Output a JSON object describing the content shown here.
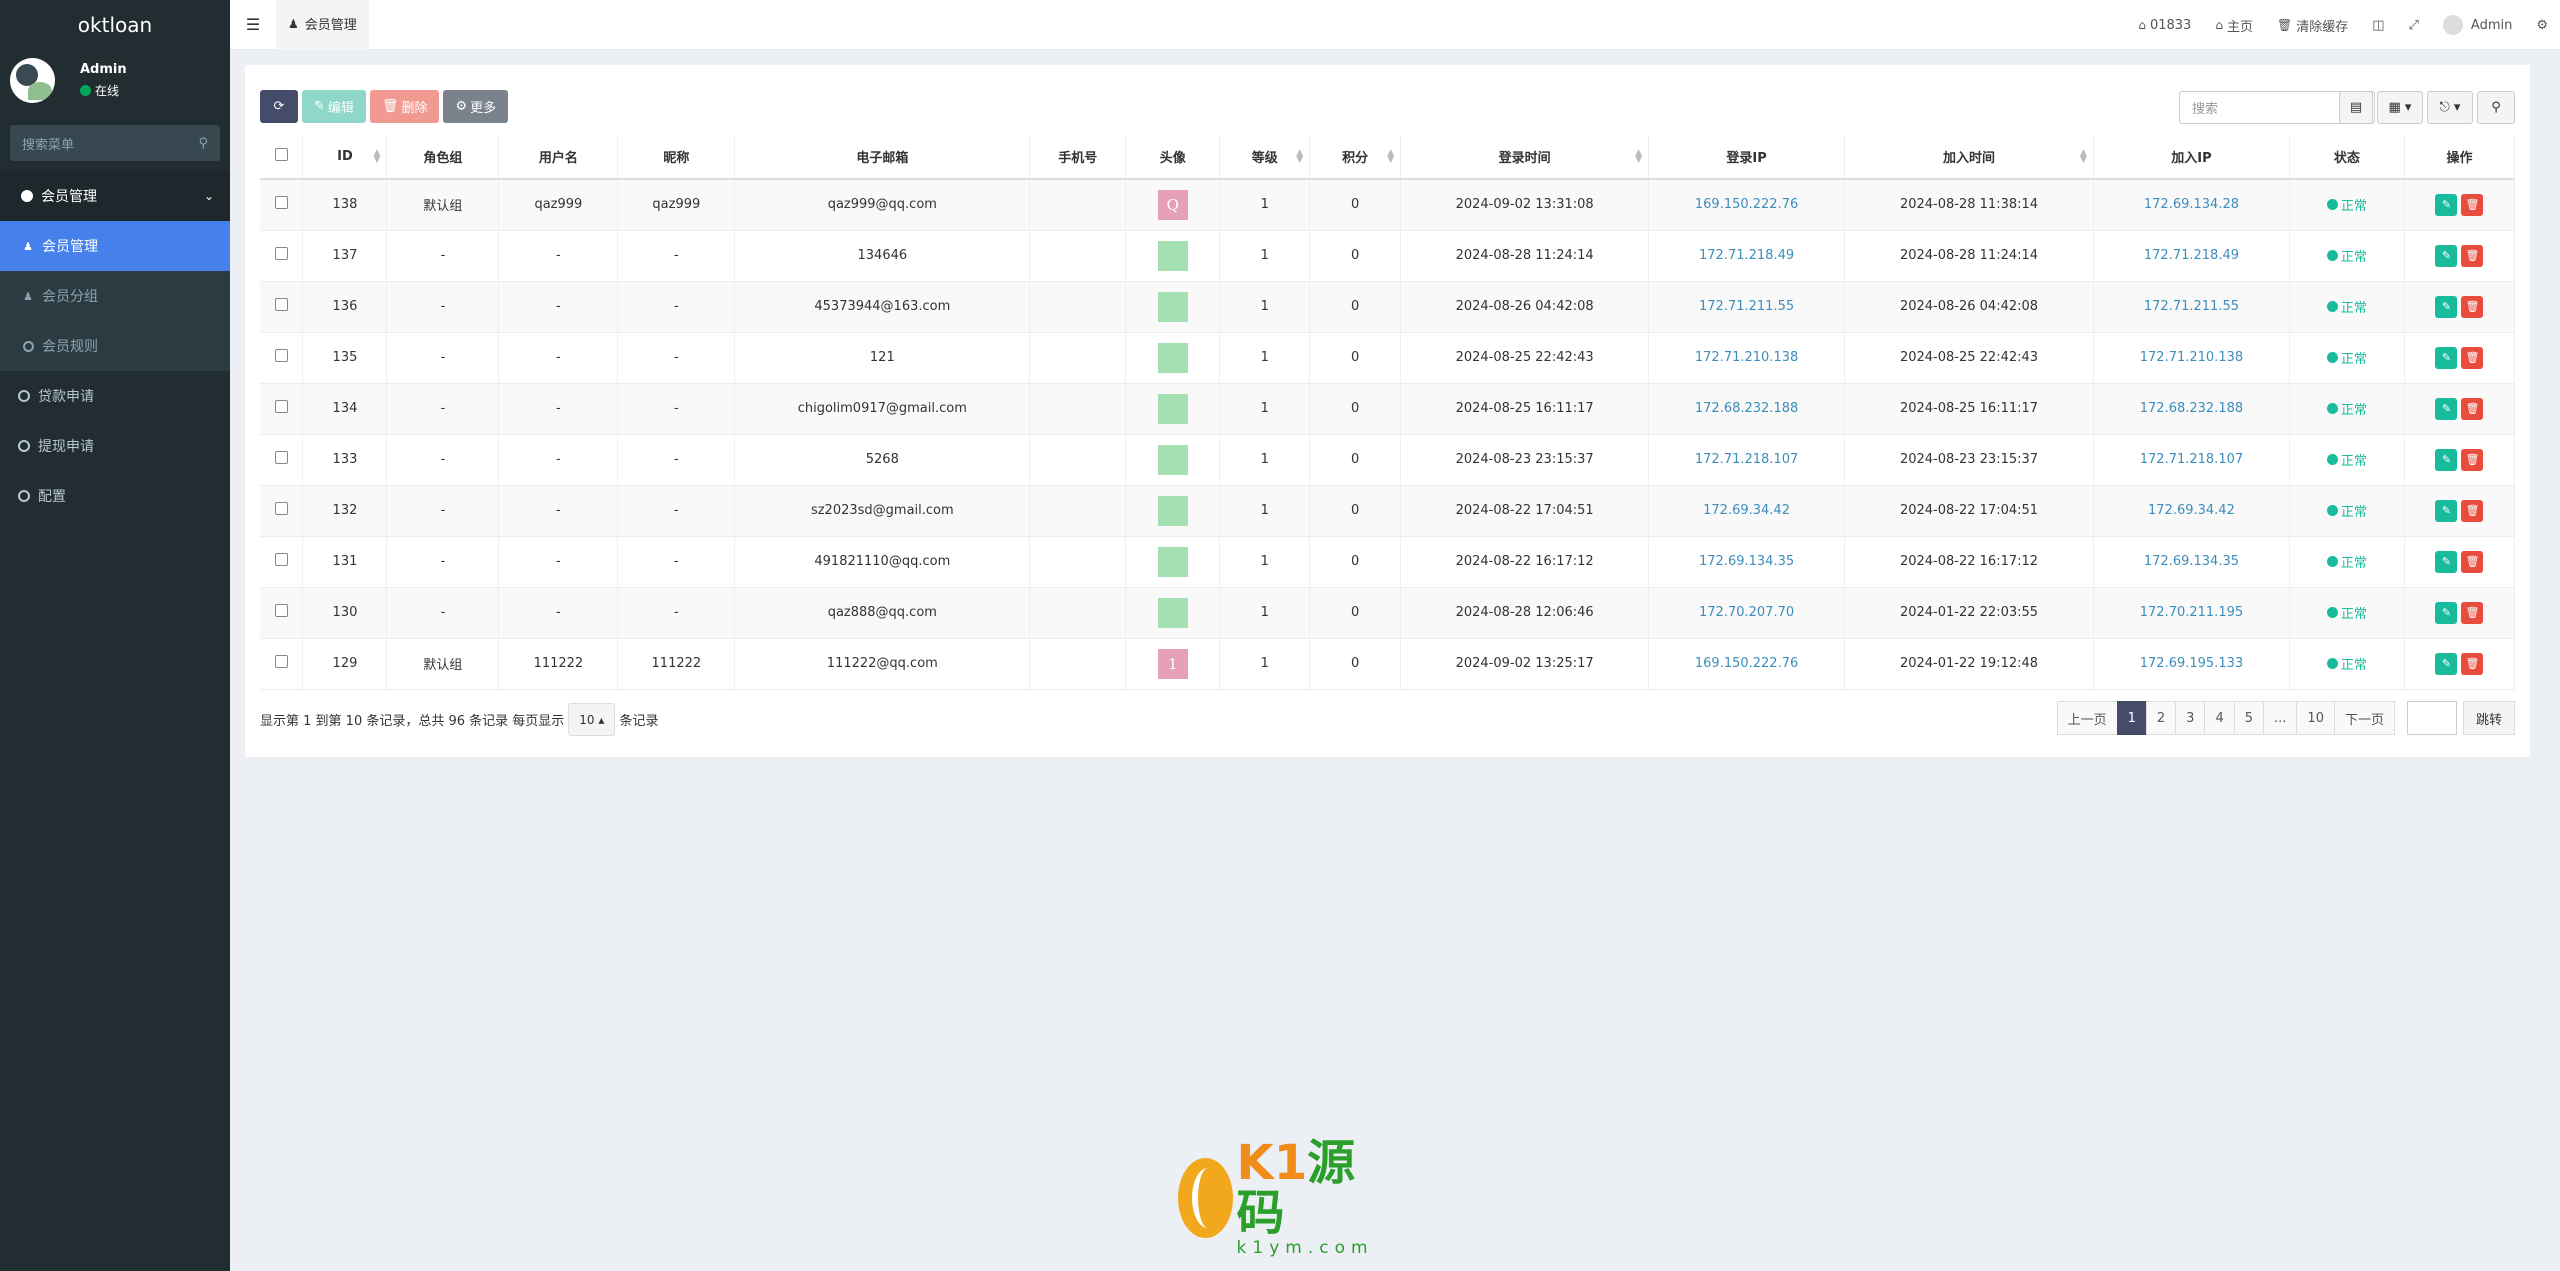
{
  "app": {
    "logo": "oktloan"
  },
  "user": {
    "name": "Admin",
    "status": "在线"
  },
  "sidebar": {
    "search_placeholder": "搜索菜单",
    "group_label": "会员管理",
    "sub_items": [
      {
        "label": "会员管理",
        "active": true,
        "icon": "user-icon"
      },
      {
        "label": "会员分组",
        "active": false,
        "icon": "users-icon"
      },
      {
        "label": "会员规则",
        "active": false,
        "icon": "circle-icon"
      }
    ],
    "items": [
      {
        "label": "贷款申请",
        "icon": "circle-icon"
      },
      {
        "label": "提现申请",
        "icon": "circle-icon"
      },
      {
        "label": "配置",
        "icon": "circle-icon"
      }
    ]
  },
  "topbar": {
    "tab_label": "会员管理",
    "code": "01833",
    "home": "主页",
    "clear_cache": "清除缓存",
    "admin": "Admin"
  },
  "toolbar": {
    "edit": "编辑",
    "delete": "删除",
    "more": "更多",
    "search_placeholder": "搜索"
  },
  "table": {
    "columns": [
      "ID",
      "角色组",
      "用户名",
      "昵称",
      "电子邮箱",
      "手机号",
      "头像",
      "等级",
      "积分",
      "登录时间",
      "登录IP",
      "加入时间",
      "加入IP",
      "状态",
      "操作"
    ],
    "rows": [
      {
        "id": "138",
        "group": "默认组",
        "username": "qaz999",
        "nickname": "qaz999",
        "email": "qaz999@qq.com",
        "mobile": "",
        "avatar_letter": "Q",
        "avatar_color": "#e7a1b6",
        "level": "1",
        "score": "0",
        "logintime": "2024-09-02 13:31:08",
        "loginip": "169.150.222.76",
        "jointime": "2024-08-28 11:38:14",
        "joinip": "172.69.134.28",
        "status": "正常"
      },
      {
        "id": "137",
        "group": "-",
        "username": "-",
        "nickname": "-",
        "email": "134646",
        "mobile": "",
        "avatar_letter": "",
        "avatar_color": "#a4e0b1",
        "level": "1",
        "score": "0",
        "logintime": "2024-08-28 11:24:14",
        "loginip": "172.71.218.49",
        "jointime": "2024-08-28 11:24:14",
        "joinip": "172.71.218.49",
        "status": "正常"
      },
      {
        "id": "136",
        "group": "-",
        "username": "-",
        "nickname": "-",
        "email": "45373944@163.com",
        "mobile": "",
        "avatar_letter": "",
        "avatar_color": "#a4e0b1",
        "level": "1",
        "score": "0",
        "logintime": "2024-08-26 04:42:08",
        "loginip": "172.71.211.55",
        "jointime": "2024-08-26 04:42:08",
        "joinip": "172.71.211.55",
        "status": "正常"
      },
      {
        "id": "135",
        "group": "-",
        "username": "-",
        "nickname": "-",
        "email": "121",
        "mobile": "",
        "avatar_letter": "",
        "avatar_color": "#a4e0b1",
        "level": "1",
        "score": "0",
        "logintime": "2024-08-25 22:42:43",
        "loginip": "172.71.210.138",
        "jointime": "2024-08-25 22:42:43",
        "joinip": "172.71.210.138",
        "status": "正常"
      },
      {
        "id": "134",
        "group": "-",
        "username": "-",
        "nickname": "-",
        "email": "chigolim0917@gmail.com",
        "mobile": "",
        "avatar_letter": "",
        "avatar_color": "#a4e0b1",
        "level": "1",
        "score": "0",
        "logintime": "2024-08-25 16:11:17",
        "loginip": "172.68.232.188",
        "jointime": "2024-08-25 16:11:17",
        "joinip": "172.68.232.188",
        "status": "正常"
      },
      {
        "id": "133",
        "group": "-",
        "username": "-",
        "nickname": "-",
        "email": "5268",
        "mobile": "",
        "avatar_letter": "",
        "avatar_color": "#a4e0b1",
        "level": "1",
        "score": "0",
        "logintime": "2024-08-23 23:15:37",
        "loginip": "172.71.218.107",
        "jointime": "2024-08-23 23:15:37",
        "joinip": "172.71.218.107",
        "status": "正常"
      },
      {
        "id": "132",
        "group": "-",
        "username": "-",
        "nickname": "-",
        "email": "sz2023sd@gmail.com",
        "mobile": "",
        "avatar_letter": "",
        "avatar_color": "#a4e0b1",
        "level": "1",
        "score": "0",
        "logintime": "2024-08-22 17:04:51",
        "loginip": "172.69.34.42",
        "jointime": "2024-08-22 17:04:51",
        "joinip": "172.69.34.42",
        "status": "正常"
      },
      {
        "id": "131",
        "group": "-",
        "username": "-",
        "nickname": "-",
        "email": "491821110@qq.com",
        "mobile": "",
        "avatar_letter": "",
        "avatar_color": "#a4e0b1",
        "level": "1",
        "score": "0",
        "logintime": "2024-08-22 16:17:12",
        "loginip": "172.69.134.35",
        "jointime": "2024-08-22 16:17:12",
        "joinip": "172.69.134.35",
        "status": "正常"
      },
      {
        "id": "130",
        "group": "-",
        "username": "-",
        "nickname": "-",
        "email": "qaz888@qq.com",
        "mobile": "",
        "avatar_letter": "",
        "avatar_color": "#a4e0b1",
        "level": "1",
        "score": "0",
        "logintime": "2024-08-28 12:06:46",
        "loginip": "172.70.207.70",
        "jointime": "2024-01-22 22:03:55",
        "joinip": "172.70.211.195",
        "status": "正常"
      },
      {
        "id": "129",
        "group": "默认组",
        "username": "111222",
        "nickname": "111222",
        "email": "111222@qq.com",
        "mobile": "",
        "avatar_letter": "1",
        "avatar_color": "#e7a1b6",
        "level": "1",
        "score": "0",
        "logintime": "2024-09-02 13:25:17",
        "loginip": "169.150.222.76",
        "jointime": "2024-01-22 19:12:48",
        "joinip": "172.69.195.133",
        "status": "正常"
      }
    ]
  },
  "footer": {
    "summary": "显示第 1 到第 10 条记录，总共 96 条记录 每页显示",
    "page_size": "10",
    "suffix": "条记录"
  },
  "pagination": {
    "prev": "上一页",
    "pages": [
      "1",
      "2",
      "3",
      "4",
      "5",
      "...",
      "10"
    ],
    "active": "1",
    "next": "下一页",
    "go": "跳转"
  },
  "watermark": {
    "brand_a": "K1",
    "brand_b": "源码",
    "domain": "k1ym.com"
  },
  "colors": {
    "sidebar": "#222d32",
    "active_menu": "#4680ea",
    "status_ok": "#18bc9c",
    "danger": "#e74c3c",
    "link": "#3c8dbc"
  }
}
